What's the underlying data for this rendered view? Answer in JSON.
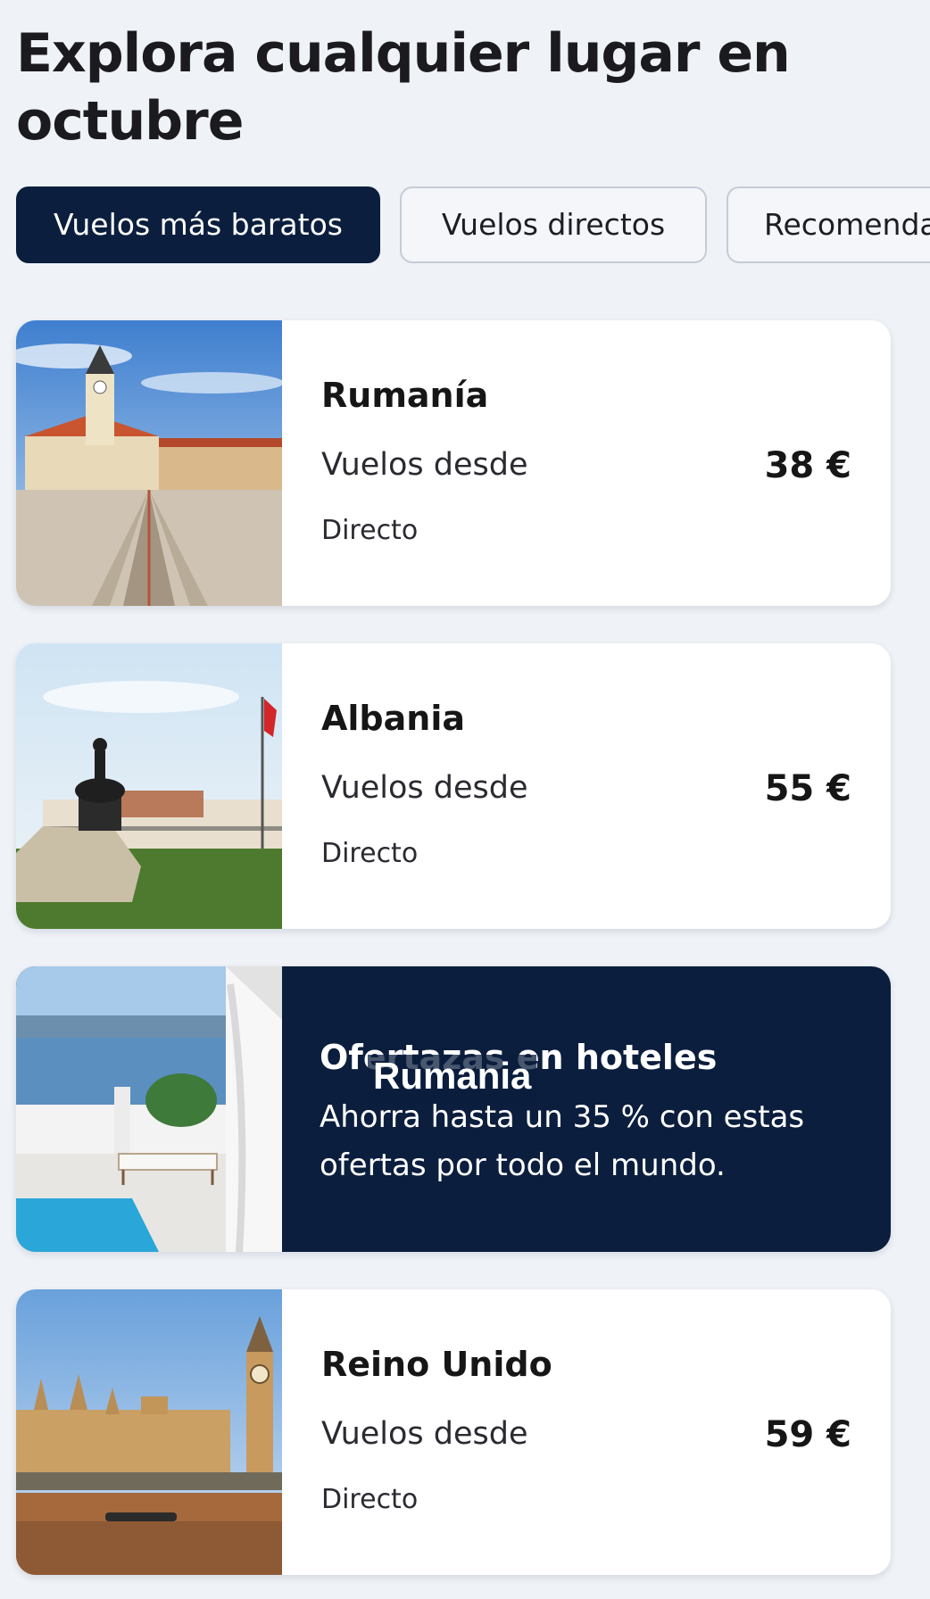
{
  "header": {
    "title": "Explora cualquier lugar en octubre"
  },
  "tabs": [
    {
      "label": "Vuelos más baratos",
      "active": true
    },
    {
      "label": "Vuelos directos",
      "active": false
    },
    {
      "label": "Recomenda",
      "active": false
    }
  ],
  "destinations": [
    {
      "name": "Rumanía",
      "from_label": "Vuelos desde",
      "price": "38 €",
      "stops": "Directo",
      "image": "brasov-council-square-photo"
    },
    {
      "name": "Albania",
      "from_label": "Vuelos desde",
      "price": "55 €",
      "stops": "Directo",
      "image": "tirana-skanderbeg-square-photo"
    },
    {
      "name": "Reino Unido",
      "from_label": "Vuelos desde",
      "price": "59 €",
      "stops": "Directo",
      "image": "westminster-big-ben-photo"
    }
  ],
  "promo": {
    "title": "Ofertazas en hoteles",
    "text": "Ahorra hasta un 35 % con estas ofertas por todo el mundo.",
    "image": "santorini-terrace-pool-photo"
  },
  "caption": {
    "text": "Rumania"
  },
  "colors": {
    "accent": "#0b1e3d",
    "background": "#eff2f7",
    "card": "#ffffff"
  }
}
